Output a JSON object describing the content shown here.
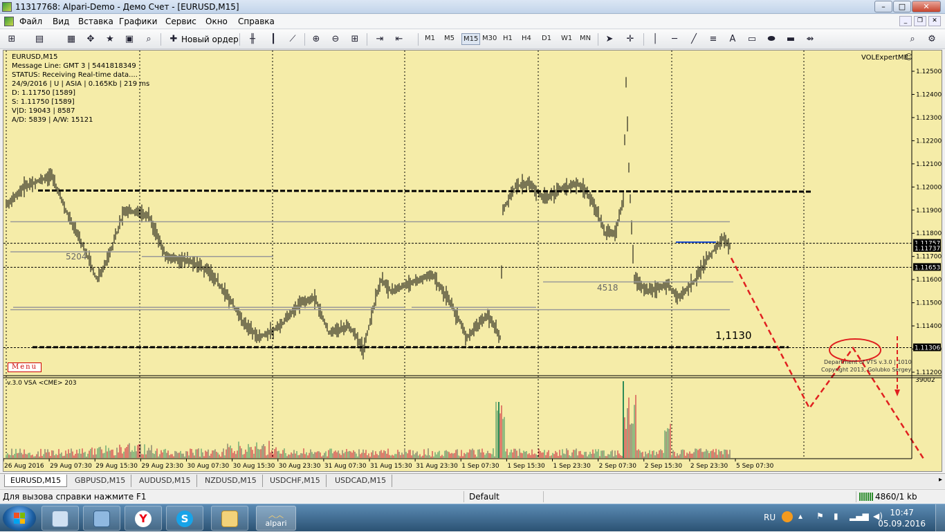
{
  "window": {
    "title": "11317768: Alpari-Demo - Демо Счет - [EURUSD,M15]",
    "minimize": "–",
    "maximize": "□",
    "close": "✕"
  },
  "menu": {
    "items": [
      "Файл",
      "Вид",
      "Вставка",
      "Графики",
      "Сервис",
      "Окно",
      "Справка"
    ]
  },
  "toolbar": {
    "new_order": "Новый ордер",
    "timeframes": [
      "M1",
      "M5",
      "M15",
      "M30",
      "H1",
      "H4",
      "D1",
      "W1",
      "MN"
    ],
    "active_timeframe": "M15"
  },
  "chart": {
    "symbol_header": "EURUSD,M15",
    "info_lines": [
      "Message Line: GMT 3 | 5441818349",
      "STATUS:  Receiving Real-time data....",
      "24/9/2016 | U | ASIA | 0.165Kb | 219 ms",
      "D: 1.11750  [1589]",
      "S: 1.11750  [1589]",
      "V|D: 19043 | 8587",
      "A/D: 5839 | A/W: 15121"
    ],
    "expert_label": "VOLExpertME",
    "menu_label": "Menu",
    "indicator_label": "v.3.0 VSA <CME> 203",
    "indicator_max": "39002",
    "copyright_1": "Department of VTS  v.3.0 | 1010",
    "copyright_2": "Copyright 2013, Golubko Sergey",
    "level_annotation": "1,1130",
    "level_volumes": [
      "5204",
      "4518"
    ],
    "price_axis": [
      "1.12500",
      "1.12400",
      "1.12300",
      "1.12200",
      "1.12100",
      "1.12000",
      "1.11900",
      "1.11800",
      "1.11700",
      "1.11600",
      "1.11500",
      "1.11400",
      "1.11300",
      "1.11200"
    ],
    "price_labels": {
      "bid": "1.11757",
      "ask": "1.11737",
      "line_mid": "1.11653",
      "line_low": "1.11306"
    },
    "time_axis": [
      "26 Aug 2016",
      "29 Aug 07:30",
      "29 Aug 15:30",
      "29 Aug 23:30",
      "30 Aug 07:30",
      "30 Aug 15:30",
      "30 Aug 23:30",
      "31 Aug 07:30",
      "31 Aug 15:30",
      "31 Aug 23:30",
      "1 Sep 07:30",
      "1 Sep 15:30",
      "1 Sep 23:30",
      "2 Sep 07:30",
      "2 Sep 15:30",
      "2 Sep 23:30",
      "5 Sep 07:30"
    ],
    "colors": {
      "background": "#f5eca8",
      "bars": "#000000",
      "forecast": "#e02020",
      "level_lines": "#000000"
    }
  },
  "tabs": [
    "EURUSD,M15",
    "GBPUSD,M15",
    "AUDUSD,M15",
    "NZDUSD,M15",
    "USDCHF,M15",
    "USDCAD,M15"
  ],
  "status": {
    "help": "Для вызова справки нажмите F1",
    "profile": "Default",
    "traffic": "4860/1 kb"
  },
  "taskbar": {
    "app_label": "alpari",
    "language": "RU",
    "time": "10:47",
    "date": "05.09.2016"
  }
}
